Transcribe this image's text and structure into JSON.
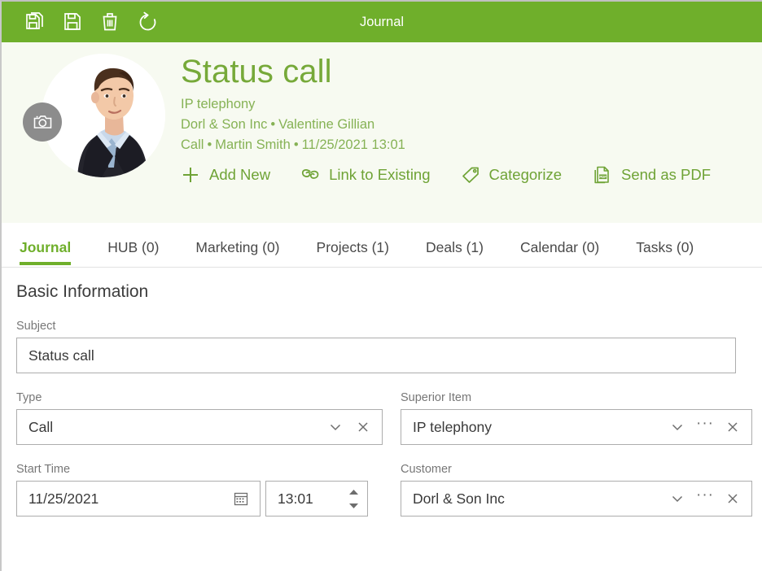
{
  "toolbar": {
    "title": "Journal",
    "buttons": [
      {
        "name": "save-and-new-icon",
        "label": "Save and New"
      },
      {
        "name": "save-icon",
        "label": "Save"
      },
      {
        "name": "delete-icon",
        "label": "Delete"
      },
      {
        "name": "refresh-icon",
        "label": "Refresh"
      }
    ]
  },
  "header": {
    "title": "Status call",
    "subtitle": "IP telephony",
    "line2_part1": "Dorl & Son Inc",
    "line2_part2": "Valentine Gillian",
    "line3_part1": "Call",
    "line3_part2": "Martin Smith",
    "line3_part3": "11/25/2021 13:01",
    "separator": "•",
    "avatar_badge": "camera-icon",
    "actions": [
      {
        "label": "Add New",
        "icon": "plus-icon"
      },
      {
        "label": "Link to Existing",
        "icon": "link-icon"
      },
      {
        "label": "Categorize",
        "icon": "tag-icon"
      },
      {
        "label": "Send as PDF",
        "icon": "pdf-icon"
      }
    ]
  },
  "tabs": [
    {
      "label": "Journal",
      "active": true
    },
    {
      "label": "HUB (0)",
      "active": false
    },
    {
      "label": "Marketing (0)",
      "active": false
    },
    {
      "label": "Projects (1)",
      "active": false
    },
    {
      "label": "Deals (1)",
      "active": false
    },
    {
      "label": "Calendar (0)",
      "active": false
    },
    {
      "label": "Tasks (0)",
      "active": false
    }
  ],
  "form": {
    "section_title": "Basic Information",
    "subject": {
      "label": "Subject",
      "value": "Status call"
    },
    "type": {
      "label": "Type",
      "value": "Call"
    },
    "superior_item": {
      "label": "Superior Item",
      "value": "IP telephony"
    },
    "start_time": {
      "label": "Start Time",
      "date": "11/25/2021",
      "time": "13:01"
    },
    "customer": {
      "label": "Customer",
      "value": "Dorl & Son Inc"
    },
    "ellipsis": "···"
  },
  "colors": {
    "brand_green": "#6FAF2B",
    "title_green": "#76A939",
    "subtitle_green": "#86B255",
    "header_bg": "#F7FAF1",
    "field_border": "#adadad"
  }
}
